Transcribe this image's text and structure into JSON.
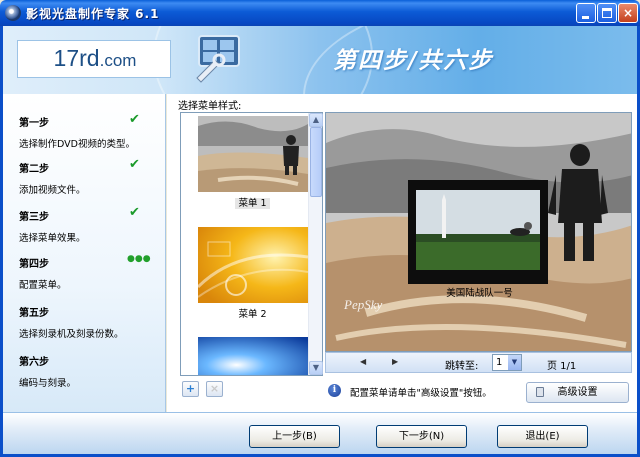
{
  "window": {
    "title": "影视光盘制作专家 6.1",
    "close_glyph": "×"
  },
  "header": {
    "logo": "17rd",
    "logo_suffix": ".com",
    "step_banner": "第四步/共六步"
  },
  "sidebar": {
    "steps": [
      {
        "title": "第一步",
        "desc": "选择制作DVD视频的类型。",
        "status": "done"
      },
      {
        "title": "第二步",
        "desc": "添加视频文件。",
        "status": "done"
      },
      {
        "title": "第三步",
        "desc": "选择菜单效果。",
        "status": "done"
      },
      {
        "title": "第四步",
        "desc": "配置菜单。",
        "status": "current"
      },
      {
        "title": "第五步",
        "desc": "选择刻录机及刻录份数。",
        "status": "pending"
      },
      {
        "title": "第六步",
        "desc": "编码与刻录。",
        "status": "pending"
      }
    ],
    "check_glyph": "✔",
    "dots_glyph": "●●●"
  },
  "main": {
    "menu_style_label": "选择菜单样式:",
    "menus": [
      {
        "caption": "菜单 1",
        "selected": true
      },
      {
        "caption": "菜单 2",
        "selected": false
      }
    ],
    "preview": {
      "video_caption": "美国陆战队一号",
      "watermark": "PepSky"
    },
    "nav": {
      "prev_glyph": "◀",
      "next_glyph": "▶",
      "jump_label": "跳转至:",
      "page_value": "1",
      "page_label": "页 1/1"
    },
    "add_glyph": "+",
    "remove_glyph": "×",
    "info_icon": "i",
    "info_text": "配置菜单请单击\"高级设置\"按钮。",
    "advanced_button": "高级设置"
  },
  "footer": {
    "prev_button": "上一步(B)",
    "next_button": "下一步(N)",
    "exit_button": "退出(E)"
  },
  "colors": {
    "titlebar": "#0747c2",
    "check": "#1a9a2a",
    "accent_blue": "#63aee8"
  }
}
